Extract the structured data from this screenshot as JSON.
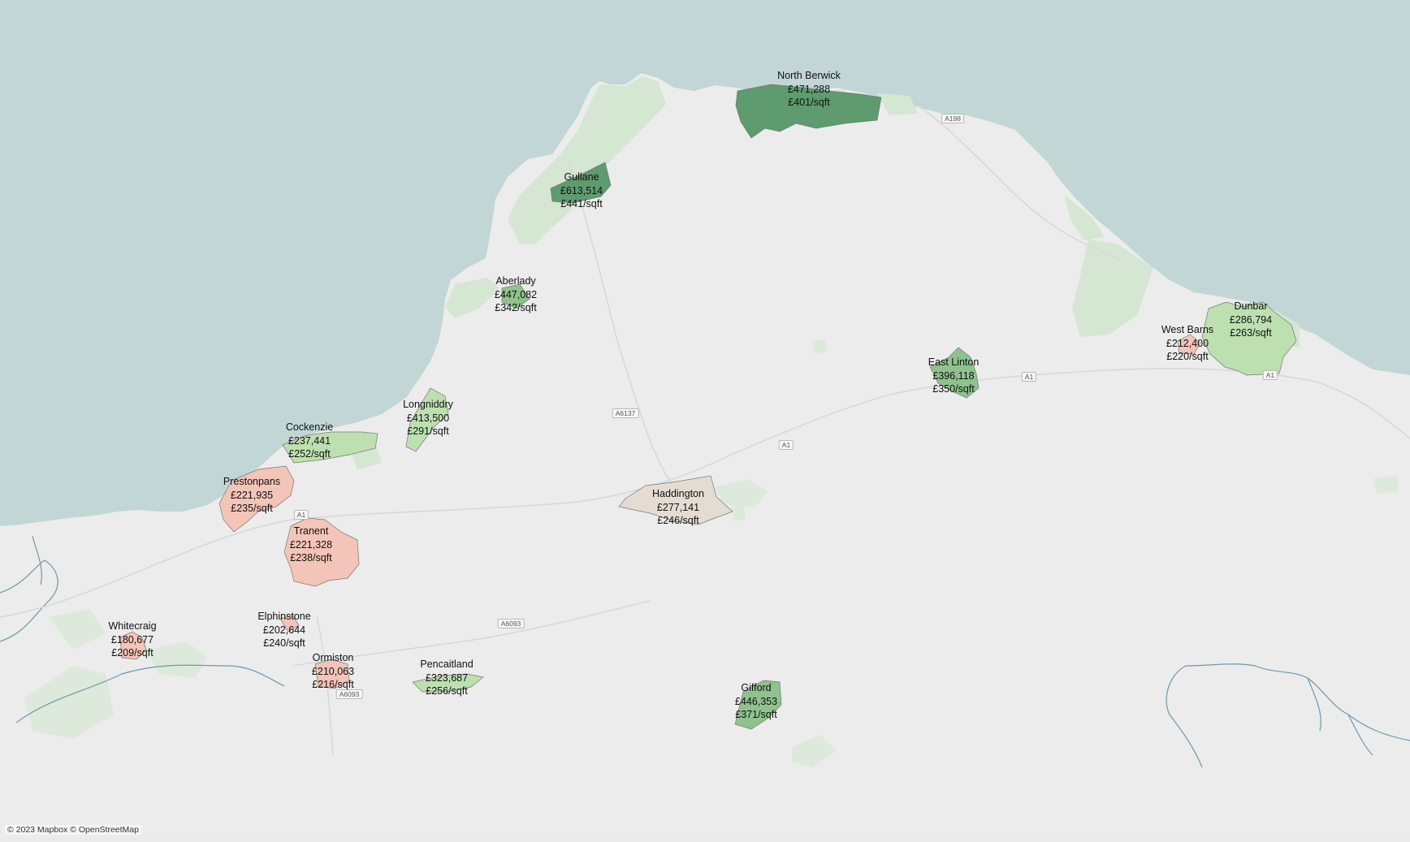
{
  "attribution": "© 2023 Mapbox © OpenStreetMap",
  "colors": {
    "sea": "#c2d6d6",
    "land": "#ececec",
    "park": "#d5e6d3",
    "river": "#6e98ad",
    "high": "#5e9b6e",
    "midhigh": "#8fc28e",
    "mid": "#bde0b0",
    "neutral": "#e4dcd2",
    "low": "#f3c4b8"
  },
  "roads": {
    "a1_west": "A1",
    "a1_centre": "A1",
    "a1_east": "A1",
    "a1_dunbar": "A1",
    "a198": "A198",
    "a6137": "A6137",
    "a6093_north": "A6093",
    "a6093_south": "A6093"
  },
  "towns": [
    {
      "name": "North Berwick",
      "price": "£471,288",
      "sqft": "£401/sqft",
      "color": "high"
    },
    {
      "name": "Gullane",
      "price": "£613,514",
      "sqft": "£441/sqft",
      "color": "high"
    },
    {
      "name": "Aberlady",
      "price": "£447,082",
      "sqft": "£342/sqft",
      "color": "midhigh"
    },
    {
      "name": "Longniddry",
      "price": "£413,500",
      "sqft": "£291/sqft",
      "color": "mid"
    },
    {
      "name": "Cockenzie",
      "price": "£237,441",
      "sqft": "£252/sqft",
      "color": "mid"
    },
    {
      "name": "Prestonpans",
      "price": "£221,935",
      "sqft": "£235/sqft",
      "color": "low"
    },
    {
      "name": "Tranent",
      "price": "£221,328",
      "sqft": "£238/sqft",
      "color": "low"
    },
    {
      "name": "Haddington",
      "price": "£277,141",
      "sqft": "£246/sqft",
      "color": "neutral"
    },
    {
      "name": "East Linton",
      "price": "£396,118",
      "sqft": "£350/sqft",
      "color": "midhigh"
    },
    {
      "name": "West Barns",
      "price": "£212,400",
      "sqft": "£220/sqft",
      "color": "low"
    },
    {
      "name": "Dunbar",
      "price": "£286,794",
      "sqft": "£263/sqft",
      "color": "mid"
    },
    {
      "name": "Whitecraig",
      "price": "£180,677",
      "sqft": "£209/sqft",
      "color": "low"
    },
    {
      "name": "Elphinstone",
      "price": "£202,644",
      "sqft": "£240/sqft",
      "color": "low"
    },
    {
      "name": "Ormiston",
      "price": "£210,063",
      "sqft": "£216/sqft",
      "color": "low"
    },
    {
      "name": "Pencaitland",
      "price": "£323,687",
      "sqft": "£256/sqft",
      "color": "mid"
    },
    {
      "name": "Gifford",
      "price": "£446,353",
      "sqft": "£371/sqft",
      "color": "midhigh"
    }
  ]
}
